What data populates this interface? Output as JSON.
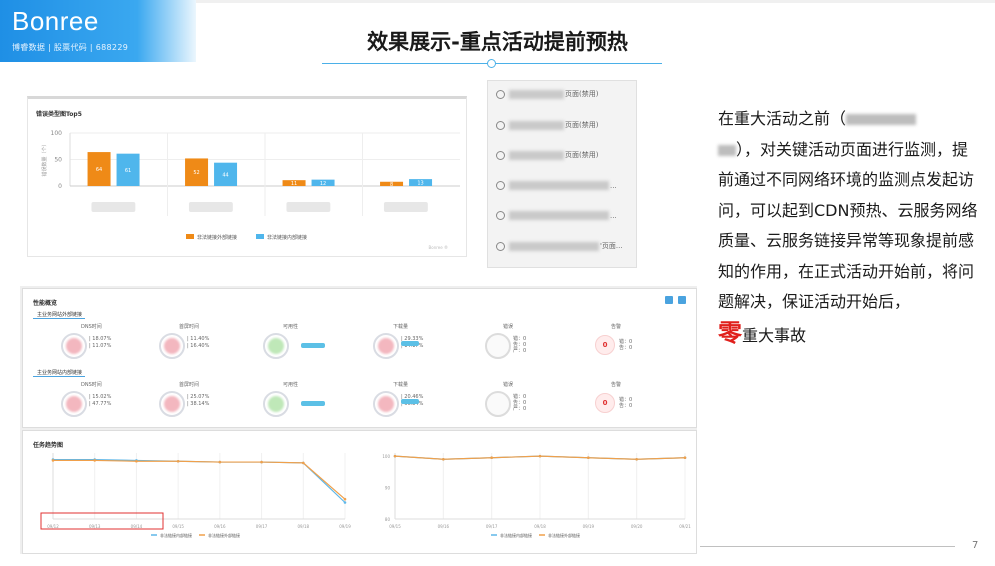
{
  "header": {
    "logo_text": "Bonree",
    "logo_subtitle": "博睿数据 | 股票代码 | 688229",
    "title": "效果展示-重点活动提前预热"
  },
  "top_chart": {
    "title": "错误类型图Top5",
    "legend": [
      "非法链接外部链接",
      "非法链接内部链接"
    ],
    "watermark": "Bonree ®",
    "chart_data": {
      "type": "bar",
      "categories": [
        "",
        "",
        "",
        ""
      ],
      "series": [
        {
          "name": "非法链接外部链接",
          "values": [
            64,
            52,
            11,
            8
          ]
        },
        {
          "name": "非法链接内部链接",
          "values": [
            61,
            44,
            12,
            13
          ]
        }
      ],
      "ylim": [
        0,
        100
      ],
      "yticks": [
        0,
        50,
        100
      ],
      "ylabel": "错误数量（个）",
      "colors": [
        "#ef8a17",
        "#4fb6ec"
      ]
    }
  },
  "task_list": {
    "items": [
      {
        "suffix": "页面(禁用)"
      },
      {
        "suffix": "页面(禁用)"
      },
      {
        "suffix": "页面(禁用)"
      },
      {
        "suffix": "..."
      },
      {
        "suffix": "..."
      },
      {
        "suffix": "'页面..."
      }
    ]
  },
  "description": {
    "line1_prefix": "在重大活动之前（",
    "line2_suffix": "），对关键活动页面进行监",
    "body": "测，提前通过不同网络环境的监测点发起访问，可以起到CDN预热、云服务网络质量、云服务链接异常等现象提前感知的作用，在正式活动开始前，将问题解决，保证活动开始后，",
    "zero": "零",
    "ending": "重大事故"
  },
  "perf_panel": {
    "title": "性能概览",
    "row1_label": "主业务网站外部链接",
    "row2_label": "主业务网站内部链接",
    "metrics": [
      "DNS时间",
      "首屏时间",
      "可用性",
      "下载量",
      "错误",
      "告警"
    ],
    "row1_values": {
      "dns": [
        "18.07%",
        "11.07%"
      ],
      "first": [
        "11.40%",
        "16.40%"
      ],
      "dl": [
        "29.33%",
        "14.17%"
      ],
      "alerts": "0"
    },
    "row2_values": {
      "dns": [
        "15.02%",
        "47.77%"
      ],
      "first": [
        "25.07%",
        "38.14%"
      ],
      "dl": [
        "20.46%",
        "66.84%"
      ],
      "alerts": "0"
    },
    "error_counts": [
      "错：0",
      "告：0",
      "严：0"
    ]
  },
  "trend_panel": {
    "title": "任务趋势图",
    "legend": [
      "非法链接内部链接",
      "非法链接外部链接"
    ],
    "left_chart": {
      "chart_data": {
        "type": "line",
        "x": [
          "09/12",
          "09/13",
          "09/14",
          "09/15",
          "09/16",
          "09/17",
          "09/18",
          "09/19"
        ],
        "series": [
          {
            "name": "非法链接内部链接",
            "values": [
              96,
              96,
              95.5,
              95,
              94.5,
              94.5,
              94,
              70
            ]
          },
          {
            "name": "非法链接外部链接",
            "values": [
              95.5,
              95.5,
              95,
              95,
              94.5,
              94.5,
              94,
              72
            ]
          }
        ],
        "colors": [
          "#5fb7e8",
          "#f0a04b"
        ]
      }
    },
    "right_chart": {
      "chart_data": {
        "type": "line",
        "x": [
          "09/15",
          "09/16",
          "09/17",
          "09/18",
          "09/19",
          "09/20",
          "09/21"
        ],
        "series": [
          {
            "name": "非法链接内部链接",
            "values": [
              100,
              99,
              99.5,
              100,
              99.5,
              99,
              99.5
            ]
          },
          {
            "name": "非法链接外部链接",
            "values": [
              100,
              99,
              99.5,
              100,
              99.5,
              99,
              99.5
            ]
          }
        ],
        "yticks": [
          80,
          90,
          100
        ],
        "colors": [
          "#5fb7e8",
          "#f0a04b"
        ]
      }
    }
  },
  "footer": {
    "page_number": "7"
  }
}
